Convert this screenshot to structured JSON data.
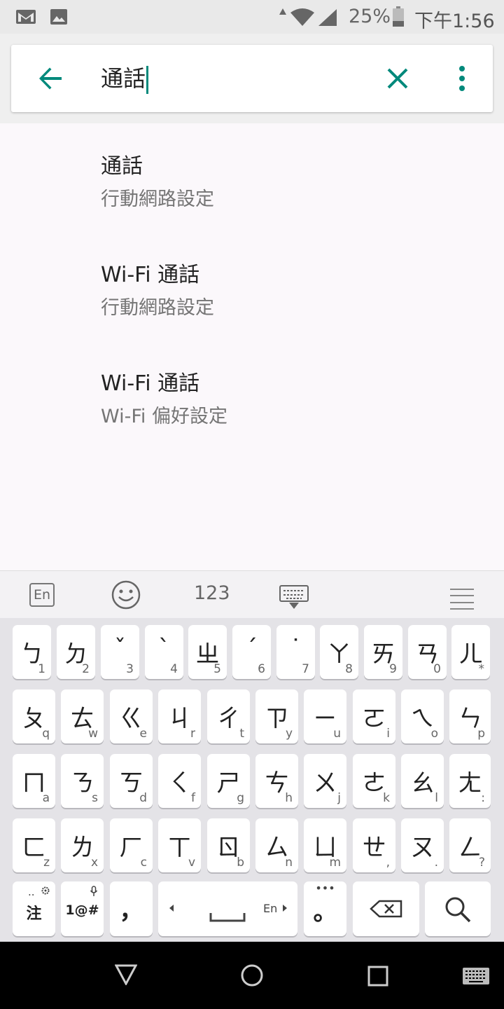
{
  "status_bar": {
    "battery_percent": "25%",
    "time": "下午1:56",
    "icons": [
      "gmail-icon",
      "image-icon",
      "wifi-icon",
      "signal-icon",
      "battery-icon"
    ]
  },
  "search": {
    "query": "通話",
    "back_icon": "arrow-back-icon",
    "clear_icon": "close-icon",
    "more_icon": "more-vert-icon"
  },
  "results": [
    {
      "title": "通話",
      "summary": "行動網路設定"
    },
    {
      "title": "Wi-Fi 通話",
      "summary": "行動網路設定"
    },
    {
      "title": "Wi-Fi 通話",
      "summary": "Wi-Fi 偏好設定"
    }
  ],
  "keyboard_toolbar": {
    "lang_label": "En",
    "numbers_label": "123"
  },
  "keyboard": {
    "row1": [
      {
        "main": "ㄅ",
        "sub": "1"
      },
      {
        "main": "ㄉ",
        "sub": "2"
      },
      {
        "main": "ˇ",
        "sub": "3"
      },
      {
        "main": "ˋ",
        "sub": "4"
      },
      {
        "main": "ㄓ",
        "sub": "5"
      },
      {
        "main": "ˊ",
        "sub": "6"
      },
      {
        "main": "˙",
        "sub": "7"
      },
      {
        "main": "ㄚ",
        "sub": "8"
      },
      {
        "main": "ㄞ",
        "sub": "9"
      },
      {
        "main": "ㄢ",
        "sub": "0"
      },
      {
        "main": "ㄦ",
        "sub": "*"
      }
    ],
    "row2": [
      {
        "main": "ㄆ",
        "sub": "q"
      },
      {
        "main": "ㄊ",
        "sub": "w"
      },
      {
        "main": "ㄍ",
        "sub": "e"
      },
      {
        "main": "ㄐ",
        "sub": "r"
      },
      {
        "main": "ㄔ",
        "sub": "t"
      },
      {
        "main": "ㄗ",
        "sub": "y"
      },
      {
        "main": "ㄧ",
        "sub": "u"
      },
      {
        "main": "ㄛ",
        "sub": "i"
      },
      {
        "main": "ㄟ",
        "sub": "o"
      },
      {
        "main": "ㄣ",
        "sub": "p"
      }
    ],
    "row3": [
      {
        "main": "ㄇ",
        "sub": "a"
      },
      {
        "main": "ㄋ",
        "sub": "s"
      },
      {
        "main": "ㄎ",
        "sub": "d"
      },
      {
        "main": "ㄑ",
        "sub": "f"
      },
      {
        "main": "ㄕ",
        "sub": "g"
      },
      {
        "main": "ㄘ",
        "sub": "h"
      },
      {
        "main": "ㄨ",
        "sub": "j"
      },
      {
        "main": "ㄜ",
        "sub": "k"
      },
      {
        "main": "ㄠ",
        "sub": "l"
      },
      {
        "main": "ㄤ",
        "sub": ":"
      }
    ],
    "row4": [
      {
        "main": "ㄈ",
        "sub": "z"
      },
      {
        "main": "ㄌ",
        "sub": "x"
      },
      {
        "main": "ㄏ",
        "sub": "c"
      },
      {
        "main": "ㄒ",
        "sub": "v"
      },
      {
        "main": "ㄖ",
        "sub": "b"
      },
      {
        "main": "ㄙ",
        "sub": "n"
      },
      {
        "main": "ㄩ",
        "sub": "m"
      },
      {
        "main": "ㄝ",
        "sub": ","
      },
      {
        "main": "ㄡ",
        "sub": "."
      },
      {
        "main": "ㄥ",
        "sub": "?"
      }
    ],
    "bottom": {
      "zhuyin_label": "注",
      "symbols_label": "1@#",
      "comma_label": "，",
      "space_lang_label": "En",
      "period_label": "。"
    }
  }
}
